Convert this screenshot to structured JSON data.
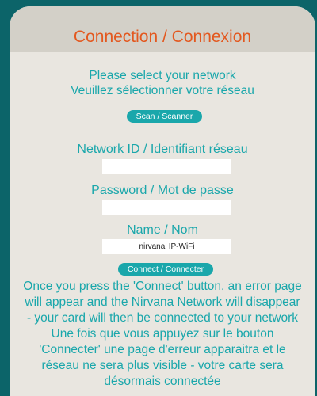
{
  "page": {
    "title": "Connection / Connexion",
    "prompt_line_1": "Please select your network",
    "prompt_line_2": "Veuillez sélectionner votre réseau",
    "scan_button": "Scan / Scanner",
    "network_label": "Network ID / Identifiant réseau",
    "network_value": "",
    "password_label": "Password / Mot de passe",
    "password_value": "",
    "name_label": "Name / Nom",
    "name_value": "nirvanaHP-WiFi",
    "connect_button": "Connect / Connecter",
    "info_lines": [
      "Once you press the 'Connect' button, an error page",
      "will appear and the Nirvana Network will disappear",
      "- your card will then be connected to your network",
      "Une fois que vous appuyez sur le bouton",
      "'Connecter' une page d'erreur apparaitra et le",
      "réseau ne sera plus visible - votre carte sera",
      "désormais connectée"
    ]
  },
  "colors": {
    "background": "#0c6469",
    "panel": "#e9e6e0",
    "header": "#d3d0c8",
    "title": "#e3581f",
    "accent": "#1aa7ab"
  }
}
